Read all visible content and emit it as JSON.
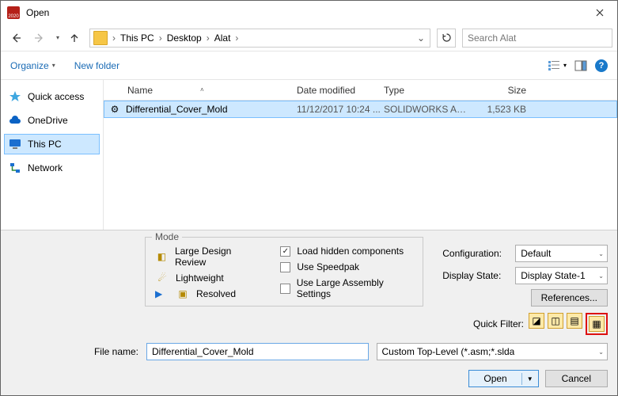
{
  "window": {
    "title": "Open"
  },
  "nav": {
    "breadcrumb": [
      "This PC",
      "Desktop",
      "Alat"
    ],
    "search_placeholder": "Search Alat"
  },
  "toolbar": {
    "organize": "Organize",
    "new_folder": "New folder"
  },
  "sidebar": {
    "items": [
      {
        "label": "Quick access"
      },
      {
        "label": "OneDrive"
      },
      {
        "label": "This PC"
      },
      {
        "label": "Network"
      }
    ]
  },
  "columns": {
    "name": "Name",
    "date": "Date modified",
    "type": "Type",
    "size": "Size"
  },
  "files": [
    {
      "name": "Differential_Cover_Mold",
      "date": "11/12/2017 10:24 ...",
      "type": "SOLIDWORKS Ass...",
      "size": "1,523 KB"
    }
  ],
  "mode": {
    "legend": "Mode",
    "options": [
      {
        "label": "Large Design Review"
      },
      {
        "label": "Lightweight"
      },
      {
        "label": "Resolved"
      }
    ],
    "checks": [
      {
        "label": "Load hidden components",
        "checked": true
      },
      {
        "label": "Use Speedpak",
        "checked": false
      },
      {
        "label": "Use Large Assembly Settings",
        "checked": false
      }
    ]
  },
  "settings": {
    "config_label": "Configuration:",
    "config_value": "Default",
    "display_label": "Display State:",
    "display_value": "Display State-1",
    "references": "References..."
  },
  "quickfilter": {
    "label": "Quick Filter:"
  },
  "footer": {
    "filename_label": "File name:",
    "filename_value": "Differential_Cover_Mold",
    "filetype": "Custom Top-Level (*.asm;*.slda",
    "open": "Open",
    "cancel": "Cancel"
  }
}
